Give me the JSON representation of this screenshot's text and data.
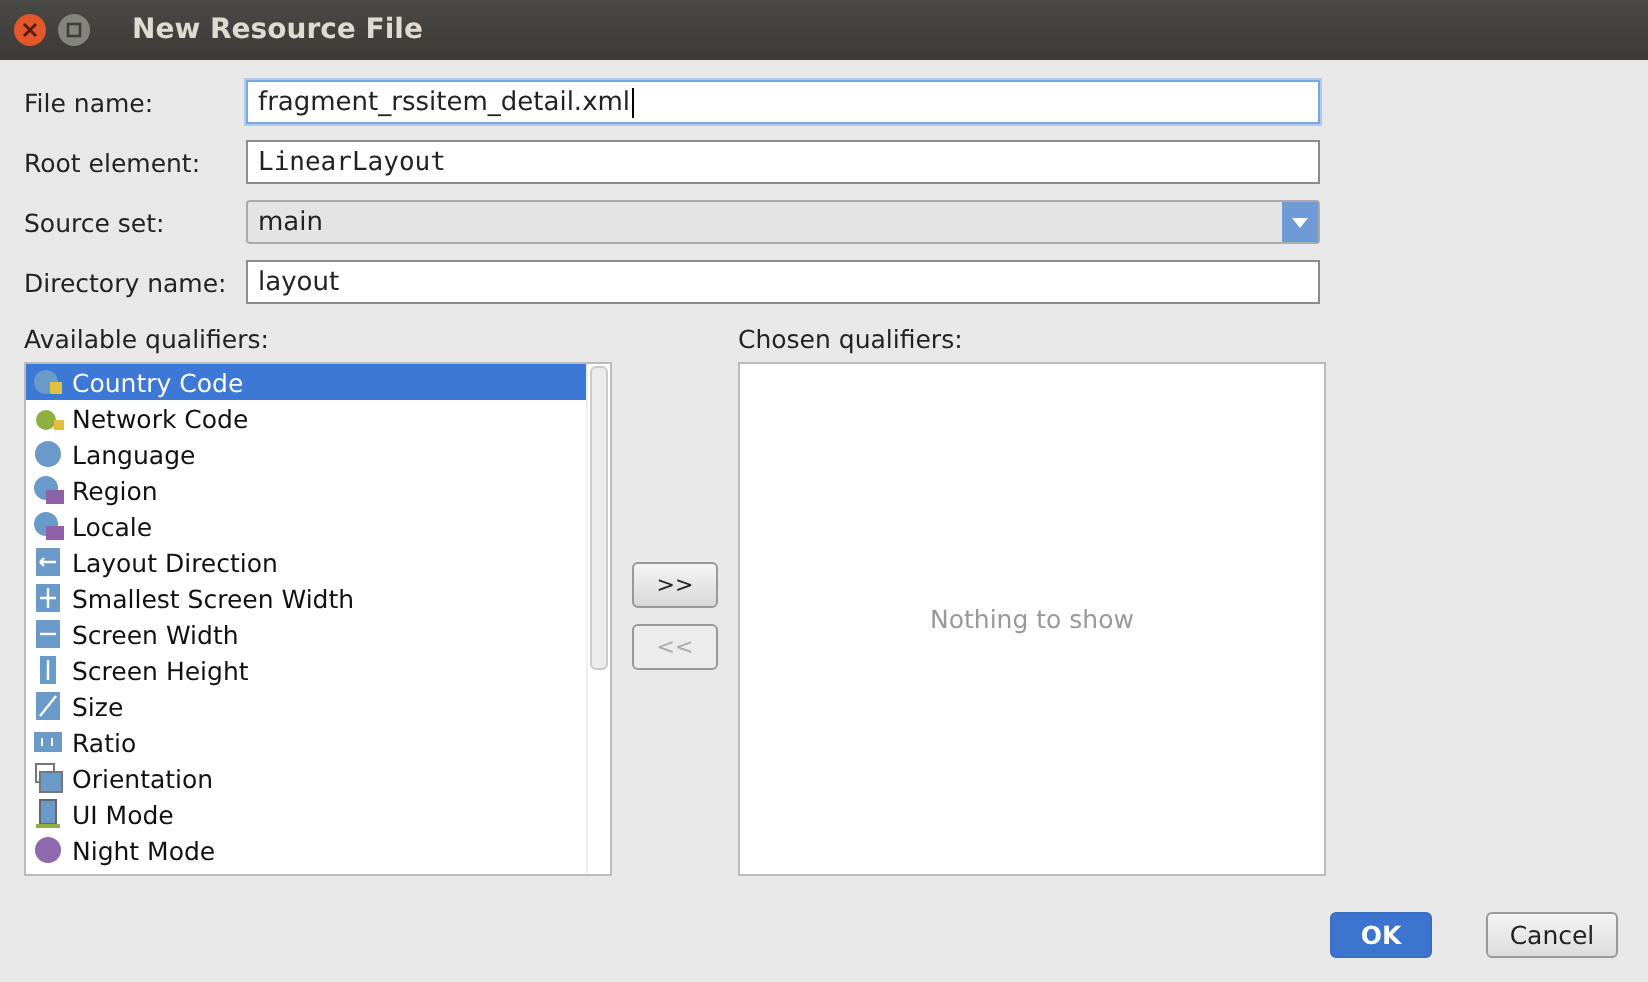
{
  "window": {
    "title": "New Resource File"
  },
  "fields": [
    {
      "kind": "text",
      "label": "File name:",
      "value": "fragment_rssitem_detail.xml",
      "focused": true
    },
    {
      "kind": "code",
      "label": "Root element:",
      "value": "LinearLayout",
      "focused": false
    },
    {
      "kind": "select",
      "label": "Source set:",
      "value": "main",
      "focused": false
    },
    {
      "kind": "text",
      "label": "Directory name:",
      "value": "layout",
      "focused": false
    }
  ],
  "available": {
    "label": "Available qualifiers:",
    "items": [
      {
        "label": "Country Code",
        "selected": true
      },
      {
        "label": "Network Code",
        "selected": false
      },
      {
        "label": "Language",
        "selected": false
      },
      {
        "label": "Region",
        "selected": false
      },
      {
        "label": "Locale",
        "selected": false
      },
      {
        "label": "Layout Direction",
        "selected": false
      },
      {
        "label": "Smallest Screen Width",
        "selected": false
      },
      {
        "label": "Screen Width",
        "selected": false
      },
      {
        "label": "Screen Height",
        "selected": false
      },
      {
        "label": "Size",
        "selected": false
      },
      {
        "label": "Ratio",
        "selected": false
      },
      {
        "label": "Orientation",
        "selected": false
      },
      {
        "label": "UI Mode",
        "selected": false
      },
      {
        "label": "Night Mode",
        "selected": false
      }
    ]
  },
  "move_buttons": [
    {
      "label": ">>",
      "disabled": false
    },
    {
      "label": "<<",
      "disabled": true
    }
  ],
  "chosen": {
    "label": "Chosen qualifiers:",
    "empty_text": "Nothing to show"
  },
  "buttons": [
    {
      "label": "OK",
      "primary": true
    },
    {
      "label": "Cancel",
      "primary": false
    }
  ]
}
